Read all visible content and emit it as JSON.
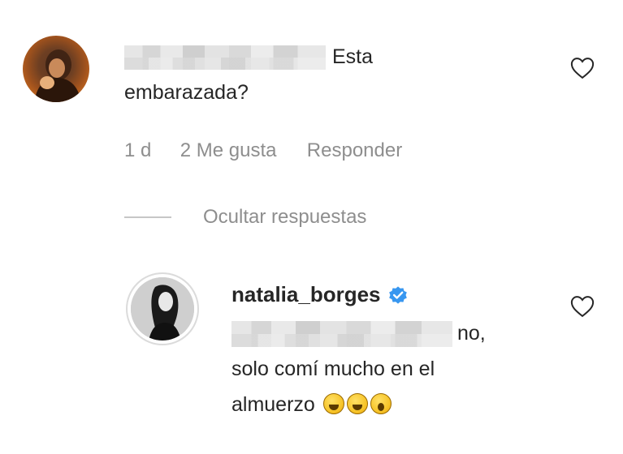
{
  "comment": {
    "text_line1": "Esta",
    "text_line2": "embarazada?",
    "time": "1 d",
    "likes": "2 Me gusta",
    "reply_label": "Responder"
  },
  "replies_toggle": {
    "label": "Ocultar respuestas"
  },
  "reply": {
    "username": "natalia_borges",
    "verified": true,
    "text_line1": "no,",
    "text_line2": "solo comí mucho en el",
    "text_line3": "almuerzo",
    "emojis": [
      "laughing-face-emoji",
      "laughing-face-emoji",
      "screaming-face-emoji"
    ]
  },
  "colors": {
    "text": "#262626",
    "secondary": "#8e8e8e",
    "verified_blue": "#3897f0"
  }
}
